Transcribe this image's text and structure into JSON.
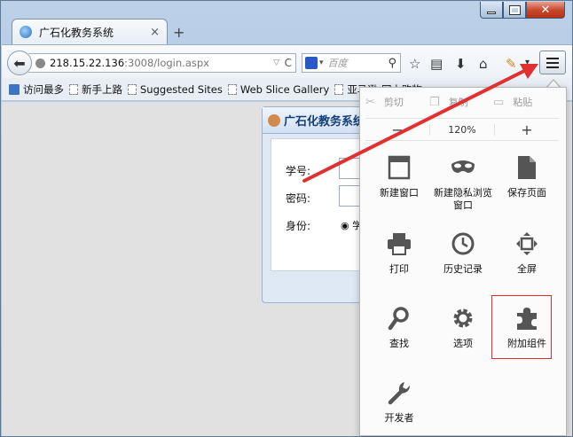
{
  "window": {
    "tab_title": "广石化教务系统",
    "new_tab": "+",
    "tab_close": "×"
  },
  "navbar": {
    "url_host": "218.15.22.136",
    "url_rest": ":3008/login.aspx",
    "search_placeholder": "百度"
  },
  "bookmarks": [
    {
      "label": "访问最多",
      "kind": "folder"
    },
    {
      "label": "新手上路",
      "kind": "page"
    },
    {
      "label": "Suggested Sites",
      "kind": "page"
    },
    {
      "label": "Web Slice Gallery",
      "kind": "page"
    },
    {
      "label": "亚马逊-网上购物",
      "kind": "page"
    }
  ],
  "login": {
    "title": "广石化教务系统登",
    "student_id_label": "学号:",
    "password_label": "密码:",
    "identity_label": "身份:",
    "identity_option": "学"
  },
  "menu": {
    "cut": "剪切",
    "copy": "复制",
    "paste": "粘贴",
    "zoom_out": "−",
    "zoom_level": "120%",
    "zoom_in": "+",
    "items": [
      {
        "label": "新建窗口",
        "icon": "window-icon"
      },
      {
        "label": "新建隐私浏览窗口",
        "icon": "mask-icon"
      },
      {
        "label": "保存页面",
        "icon": "page-icon"
      },
      {
        "label": "打印",
        "icon": "printer-icon"
      },
      {
        "label": "历史记录",
        "icon": "clock-icon"
      },
      {
        "label": "全屏",
        "icon": "fullscreen-icon"
      },
      {
        "label": "查找",
        "icon": "magnifier-icon"
      },
      {
        "label": "选项",
        "icon": "gear-icon"
      },
      {
        "label": "附加组件",
        "icon": "puzzle-icon"
      },
      {
        "label": "开发者",
        "icon": "wrench-icon"
      }
    ],
    "highlighted_item": "附加组件"
  },
  "colors": {
    "annotation": "#e03030",
    "menu_bg": "#fbfbfb"
  }
}
